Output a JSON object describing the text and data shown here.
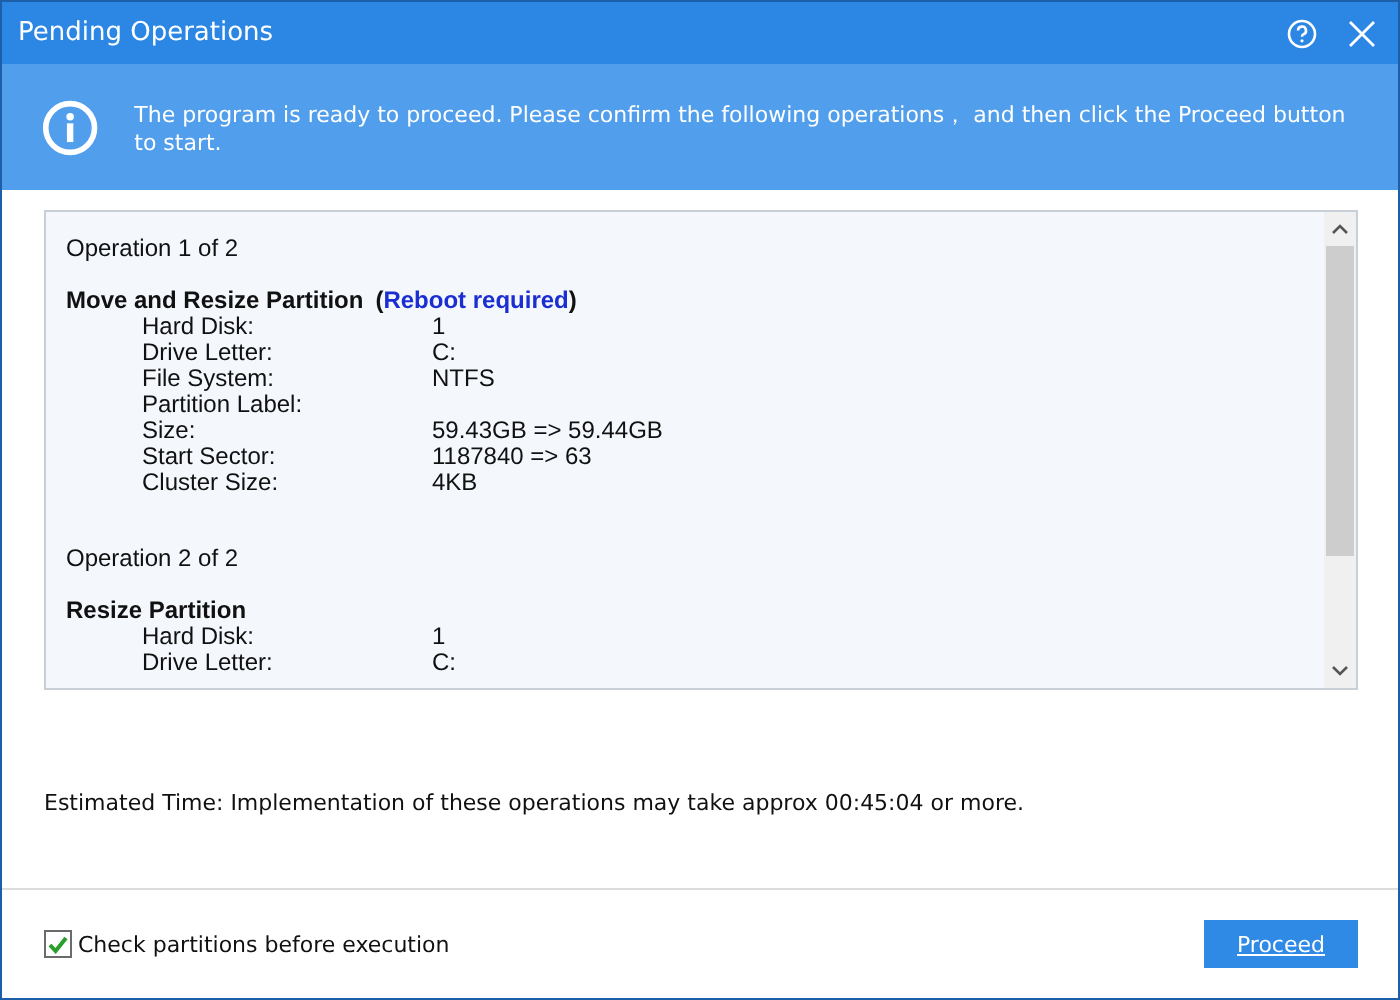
{
  "window": {
    "title": "Pending Operations"
  },
  "banner": {
    "message": "The program is ready to proceed. Please confirm the following operations，  and then click the Proceed button to start."
  },
  "operations": [
    {
      "header": "Operation 1 of 2",
      "title": "Move and Resize Partition",
      "note": {
        "open": "(",
        "text": "Reboot required",
        "close": ")"
      },
      "fields": [
        {
          "label": "Hard Disk:",
          "value": "1"
        },
        {
          "label": "Drive Letter:",
          "value": "C:"
        },
        {
          "label": "File System:",
          "value": "NTFS"
        },
        {
          "label": "Partition Label:"
        },
        {
          "label": "Size:",
          "value": "59.43GB => 59.44GB"
        },
        {
          "label": "Start Sector:",
          "value": "1187840 => 63"
        },
        {
          "label": "Cluster Size:",
          "value": "4KB"
        }
      ]
    },
    {
      "header": "Operation 2 of 2",
      "title": "Resize Partition",
      "fields": [
        {
          "label": "Hard Disk:",
          "value": "1"
        },
        {
          "label": "Drive Letter:",
          "value": "C:"
        }
      ]
    }
  ],
  "estimate": "Estimated Time: Implementation of these operations may take approx 00:45:04 or more.",
  "footer": {
    "check": {
      "label": "Check partitions before execution",
      "checked": true
    },
    "button": "Proceed"
  }
}
